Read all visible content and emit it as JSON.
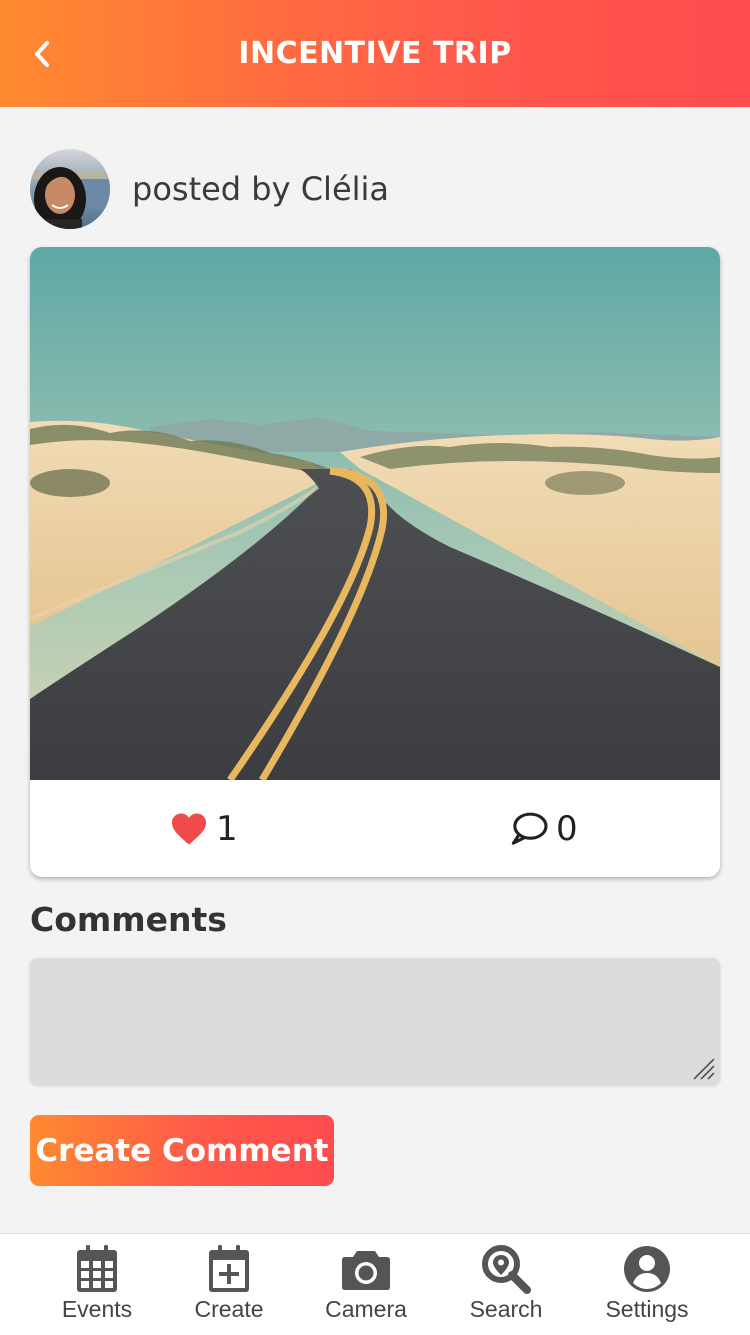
{
  "header": {
    "title": "INCENTIVE TRIP",
    "back_icon": "chevron-left-icon",
    "gradient_start": "#ff8a30",
    "gradient_end": "#ff4c4f"
  },
  "post": {
    "author_text": "posted by Clélia",
    "likes": "1",
    "comments_count": "0",
    "like_icon": "heart-icon",
    "like_color": "#f04a4a",
    "comment_icon": "speech-bubble-icon"
  },
  "comments": {
    "heading": "Comments",
    "input_value": "",
    "button_label": "Create Comment"
  },
  "tabbar": {
    "items": [
      {
        "label": "Events",
        "icon": "calendar-grid-icon"
      },
      {
        "label": "Create",
        "icon": "calendar-plus-icon"
      },
      {
        "label": "Camera",
        "icon": "camera-icon"
      },
      {
        "label": "Search",
        "icon": "search-location-icon"
      },
      {
        "label": "Settings",
        "icon": "user-circle-icon"
      }
    ]
  }
}
